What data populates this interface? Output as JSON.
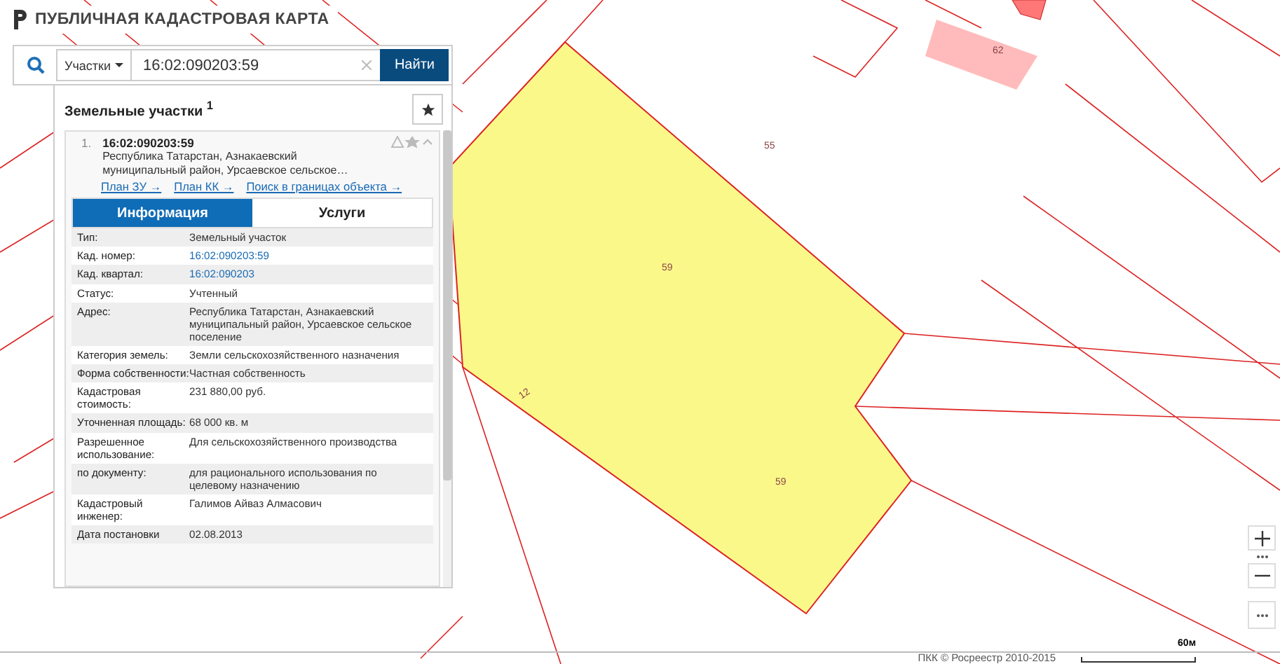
{
  "header": {
    "title": "ПУБЛИЧНАЯ КАДАСТРОВАЯ КАРТА"
  },
  "search": {
    "type_dropdown": "Участки",
    "value": "16:02:090203:59",
    "button": "Найти"
  },
  "results": {
    "title": "Земельные участки $^{1}$",
    "item": {
      "number": "1.",
      "cad_number": "16:02:090203:59",
      "address": "Республика Татарстан, Азнакаевский муниципальный район, Урсаевское сельское…",
      "links": [
        "План ЗУ →",
        "План КК →",
        "Поиск в границах объекта →"
      ],
      "tabs": [
        {
          "label": "Информация",
          "selected": true
        },
        {
          "label": "Услуги",
          "selected": false
        }
      ],
      "attributes": [
        {
          "label": "Тип:",
          "value": "Земельный участок",
          "link": false
        },
        {
          "label": "Кад. номер:",
          "value": "16:02:090203:59",
          "link": true
        },
        {
          "label": "Кад. квартал:",
          "value": "16:02:090203",
          "link": true
        },
        {
          "label": "Статус:",
          "value": "Учтенный",
          "link": false
        },
        {
          "label": "Адрес:",
          "value": "Республика Татарстан, Азнакаевский муниципальный район, Урсаевское сельское поселение",
          "link": false
        },
        {
          "label": "Категория земель:",
          "value": "Земли сельскохозяйственного назначения",
          "link": false
        },
        {
          "label": "Форма собственности:",
          "value": "Частная собственность",
          "link": false
        },
        {
          "label": "Кадастровая стоимость:",
          "value": "231 880,00 руб.",
          "link": false
        },
        {
          "label": "Уточненная площадь:",
          "value": "68 000 кв. м",
          "link": false
        },
        {
          "label": "Разрешенное использование:",
          "value": "Для сельскохозяйственного производства",
          "link": false
        },
        {
          "label": "по документу:",
          "value": "для рационального использования по целевому назначению",
          "link": false
        },
        {
          "label": "Кадастровый инженер:",
          "value": "Галимов Айваз Алмасович",
          "link": false
        },
        {
          "label": "Дата постановки",
          "value": "02.08.2013",
          "link": false
        }
      ]
    }
  },
  "map": {
    "labels": [
      "55",
      "59",
      "59",
      "12",
      "62"
    ]
  },
  "footer": {
    "copyright": "ПКК © Росреестр 2010-2015",
    "scale": "60м"
  }
}
